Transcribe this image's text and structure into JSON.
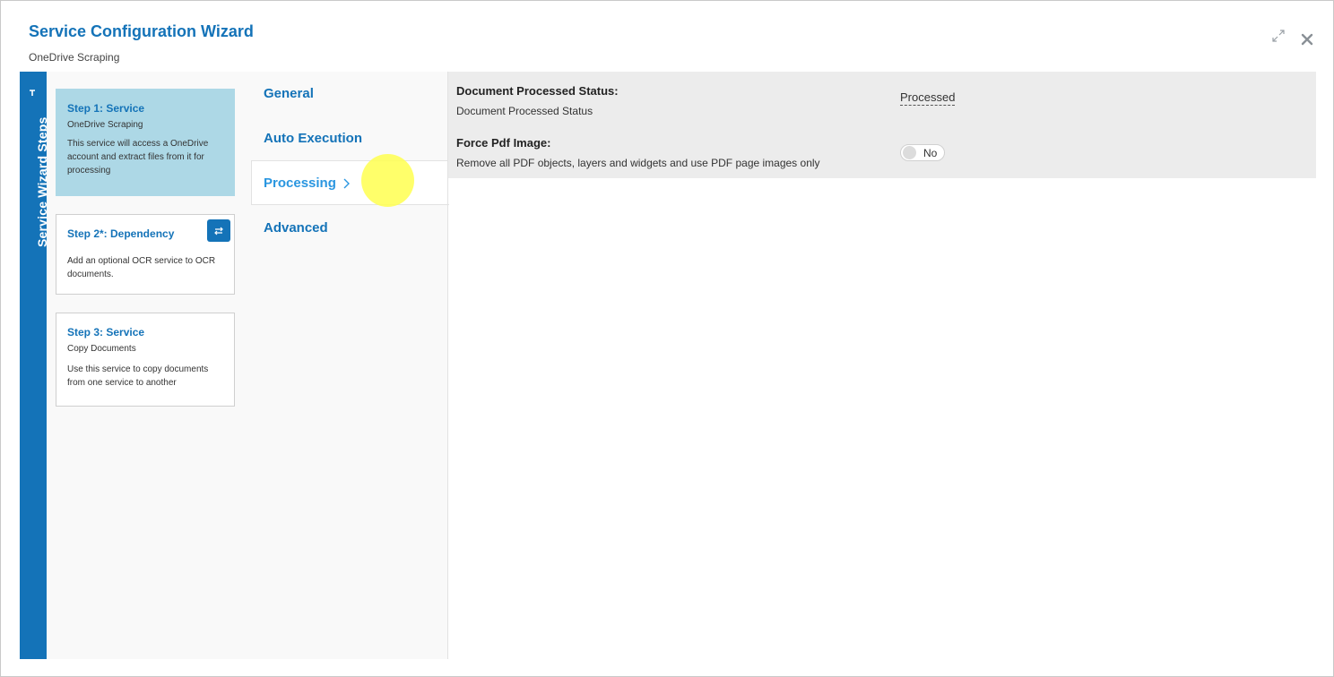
{
  "window": {
    "title": "Service Configuration Wizard",
    "subtitle": "OneDrive Scraping",
    "expand_icon": "expand-icon",
    "close_icon": "close-icon"
  },
  "sidebar": {
    "label": "Service Wizard Steps",
    "pin_icon": "pin-icon"
  },
  "steps": [
    {
      "title": "Step 1: Service",
      "name": "OneDrive Scraping",
      "description": "This service will access a OneDrive account and extract files from it for processing",
      "active": true
    },
    {
      "title": "Step 2*: Dependency",
      "name": "",
      "description": "Add an optional OCR service to OCR documents.",
      "active": false,
      "action_icon": "swap-icon"
    },
    {
      "title": "Step 3: Service",
      "name": "Copy Documents",
      "description": "Use this service to copy documents from one service to another",
      "active": false
    }
  ],
  "tabs": [
    {
      "label": "General",
      "active": false
    },
    {
      "label": "Auto Execution",
      "active": false
    },
    {
      "label": "Processing",
      "active": true
    },
    {
      "label": "Advanced",
      "active": false
    }
  ],
  "settings": {
    "document_processed_status": {
      "label": "Document Processed Status:",
      "description": "Document Processed Status",
      "value": "Processed"
    },
    "force_pdf_image": {
      "label": "Force Pdf Image:",
      "description": "Remove all PDF objects, layers and widgets and use PDF page images only",
      "value": "No"
    }
  },
  "colors": {
    "accent": "#1473b8",
    "active_step": "#add8e6",
    "active_tab": "#2a96e0",
    "panel_bg": "#ececec"
  }
}
